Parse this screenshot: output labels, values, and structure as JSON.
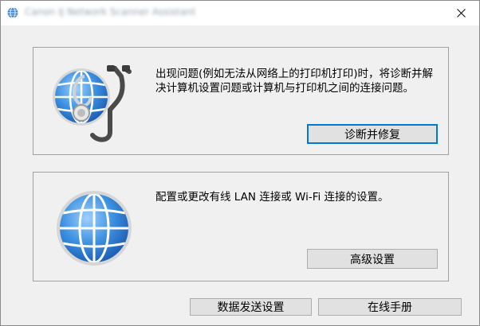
{
  "window": {
    "title": "Canon IJ Network Scanner Assistant"
  },
  "diagnose_panel": {
    "description": "出现问题(例如无法从网络上的打印机打印)时，将诊断并解决计算机设置问题或计算机与打印机之间的连接问题。",
    "button_label": "诊断并修复"
  },
  "advanced_panel": {
    "description": "配置或更改有线 LAN 连接或 Wi-Fi 连接的设置。",
    "button_label": "高级设置"
  },
  "footer": {
    "send_data_label": "数据发送设置",
    "online_manual_label": "在线手册"
  },
  "colors": {
    "accent": "#0078d7",
    "globe_blue": "#3b8fe0"
  },
  "icons": {
    "diagnose": "globe-stethoscope-icon",
    "advanced": "globe-icon",
    "close": "close-icon"
  }
}
